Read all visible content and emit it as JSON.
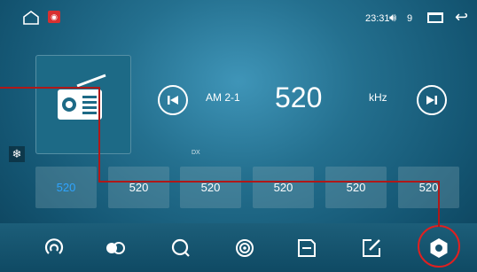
{
  "status_bar": {
    "time": "23:31",
    "volume_level": "9",
    "icons": [
      "home-icon",
      "radio-app-icon",
      "volume-icon",
      "recents-icon",
      "back-icon"
    ]
  },
  "radio": {
    "band": "AM 2-1",
    "frequency": "520",
    "unit": "kHz",
    "dx_label": "DX"
  },
  "presets": [
    {
      "label": "520",
      "active": true
    },
    {
      "label": "520",
      "active": false
    },
    {
      "label": "520",
      "active": false
    },
    {
      "label": "520",
      "active": false
    },
    {
      "label": "520",
      "active": false
    },
    {
      "label": "520",
      "active": false
    }
  ],
  "bottom_bar": {
    "icons": [
      "scan-icon",
      "toggle-icon",
      "search-icon",
      "broadcast-icon",
      "save-icon",
      "edit-icon",
      "settings-icon"
    ]
  },
  "colors": {
    "accent_active": "#2fa4ff",
    "annotation": "#b01818"
  }
}
